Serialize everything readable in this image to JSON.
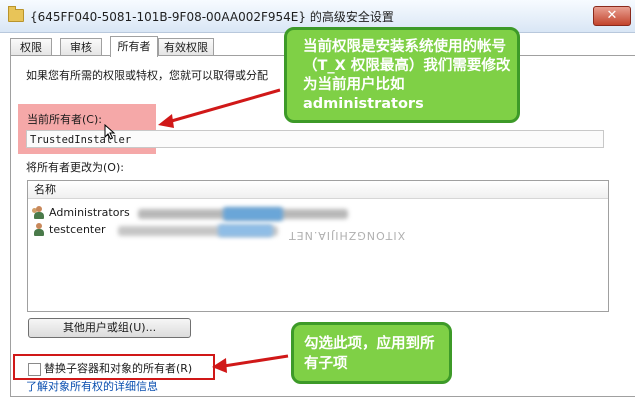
{
  "window": {
    "title": "{645FF040-5081-101B-9F08-00AA002F954E} 的高级安全设置",
    "close_label": "✕"
  },
  "tabs": [
    {
      "label": "权限"
    },
    {
      "label": "审核"
    },
    {
      "label": "所有者",
      "active": true
    },
    {
      "label": "有效权限"
    }
  ],
  "owner_tab": {
    "instructions": "如果您有所需的权限或特权，您就可以取得或分配",
    "current_owner_label": "当前所有者(C):",
    "current_owner_value": "TrustedInstaller",
    "change_owner_label": "将所有者更改为(O):",
    "list_header": "名称",
    "list_items": [
      {
        "name": "Administrators",
        "icon": "group-users-icon"
      },
      {
        "name": "testcenter",
        "icon": "user-icon"
      }
    ],
    "other_users_button": "其他用户或组(U)...",
    "replace_checkbox_label": "替换子容器和对象的所有者(R)",
    "replace_checked": false,
    "details_link": "了解对象所有权的详细信息"
  },
  "watermark": "XITONGZHIJIA.NET",
  "annotations": {
    "callout_owner": "当前权限是安装系统使用的帐号（T_X 权限最高）我们需要修改为当前用户比如administrators",
    "callout_checkbox": "勾选此项，应用到所有子项",
    "callout_color": "#7fd046",
    "arrow_color": "#d01818",
    "highlight_color": "#ec6060"
  }
}
